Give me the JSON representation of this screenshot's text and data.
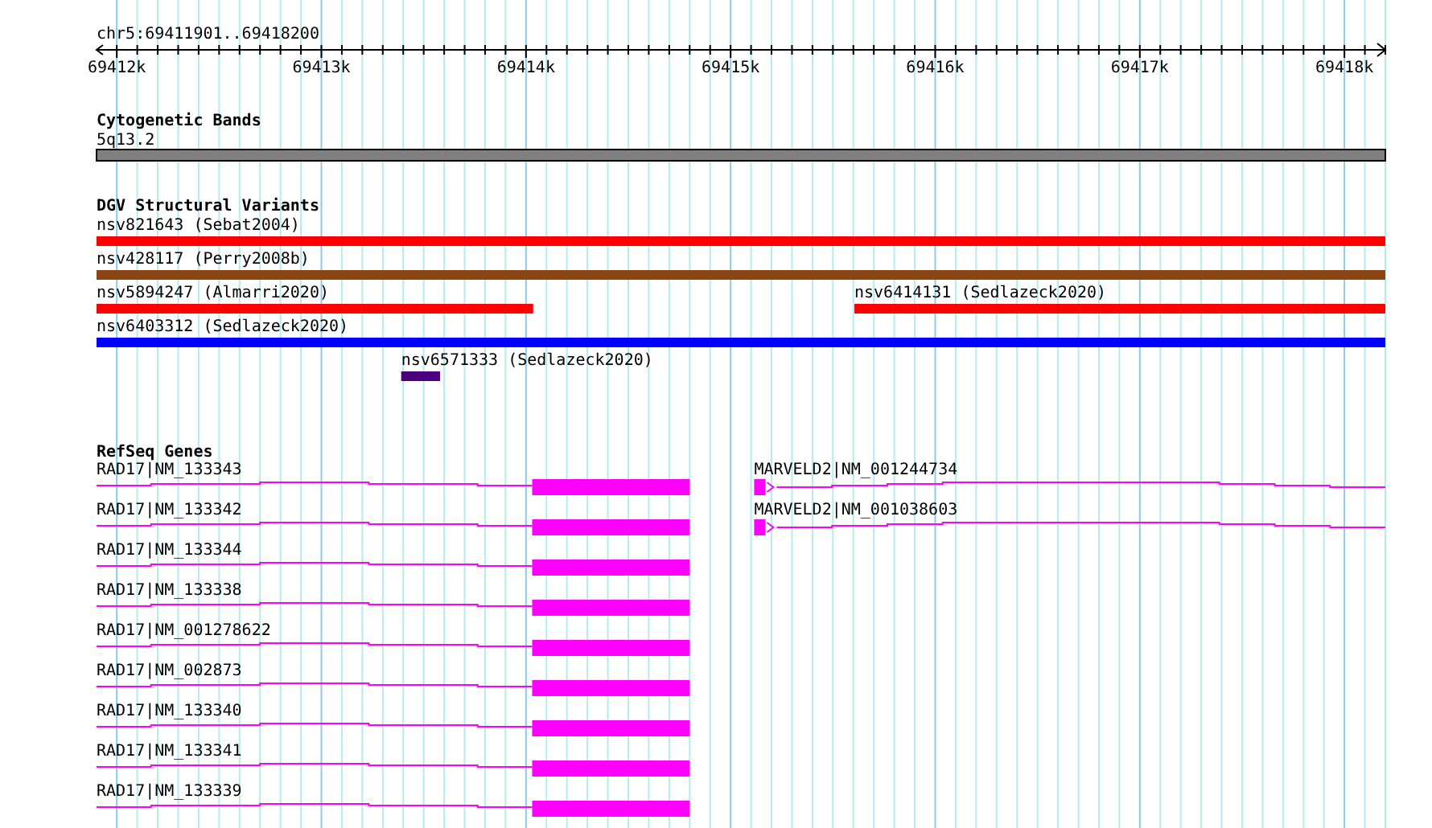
{
  "ruler": {
    "region": "chr5:69411901..69418200",
    "ticks": [
      {
        "label": "69412k"
      },
      {
        "label": "69413k"
      },
      {
        "label": "69414k"
      },
      {
        "label": "69415k"
      },
      {
        "label": "69416k"
      },
      {
        "label": "69417k"
      },
      {
        "label": "69418k"
      }
    ]
  },
  "cytogenetic_bands": {
    "title": "Cytogenetic Bands",
    "bands": [
      {
        "name": "5q13.2",
        "color": "#808080"
      }
    ]
  },
  "structural_variants": {
    "title": "DGV Structural Variants",
    "rows": [
      [
        {
          "label": "nsv821643 (Sebat2004)",
          "color": "#ff0000"
        }
      ],
      [
        {
          "label": "nsv428117 (Perry2008b)",
          "color": "#8b4513"
        }
      ],
      [
        {
          "label": "nsv5894247 (Almarri2020)",
          "color": "#ff0000"
        },
        {
          "label": "nsv6414131 (Sedlazeck2020)",
          "color": "#ff0000"
        }
      ],
      [
        {
          "label": "nsv6403312 (Sedlazeck2020)",
          "color": "#0000ff"
        }
      ],
      [
        {
          "label": "nsv6571333 (Sedlazeck2020)",
          "color": "#4b0082"
        }
      ]
    ]
  },
  "refseq_genes": {
    "title": "RefSeq Genes",
    "rows": [
      [
        {
          "label": "RAD17|NM_133343",
          "strand_arrow": false
        },
        {
          "label": "MARVELD2|NM_001244734",
          "strand_arrow": true
        }
      ],
      [
        {
          "label": "RAD17|NM_133342",
          "strand_arrow": false
        },
        {
          "label": "MARVELD2|NM_001038603",
          "strand_arrow": true
        }
      ],
      [
        {
          "label": "RAD17|NM_133344",
          "strand_arrow": false
        }
      ],
      [
        {
          "label": "RAD17|NM_133338",
          "strand_arrow": false
        }
      ],
      [
        {
          "label": "RAD17|NM_001278622",
          "strand_arrow": false
        }
      ],
      [
        {
          "label": "RAD17|NM_002873",
          "strand_arrow": false
        }
      ],
      [
        {
          "label": "RAD17|NM_133340",
          "strand_arrow": false
        }
      ],
      [
        {
          "label": "RAD17|NM_133341",
          "strand_arrow": false
        }
      ],
      [
        {
          "label": "RAD17|NM_133339",
          "strand_arrow": false
        }
      ]
    ]
  }
}
